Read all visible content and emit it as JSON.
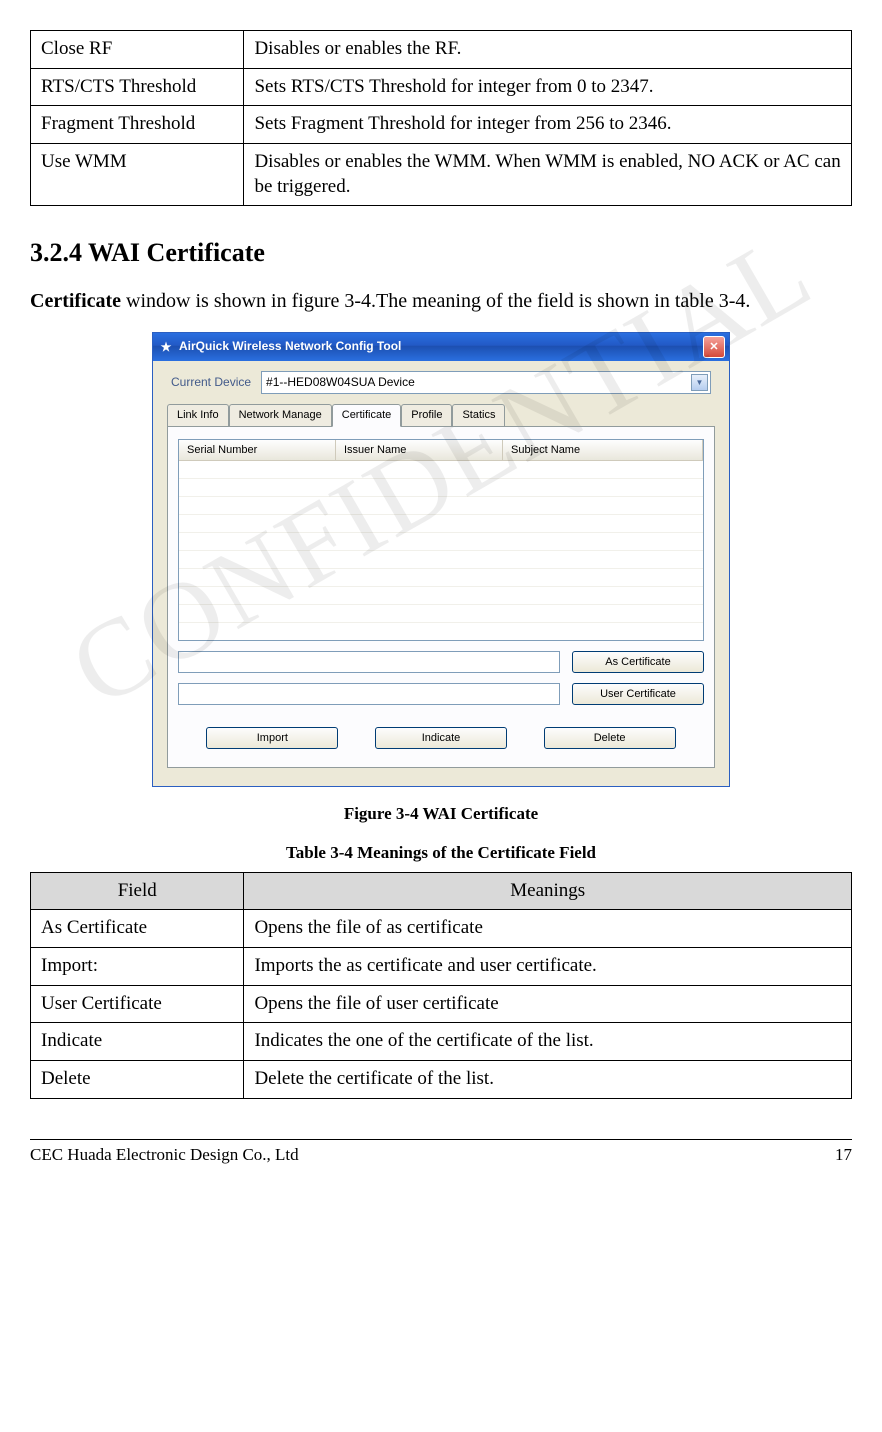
{
  "watermark": "CONFIDENTIAL",
  "topTable": [
    {
      "field": "Close RF",
      "meaning": "Disables or enables the RF."
    },
    {
      "field": "RTS/CTS Threshold",
      "meaning": "Sets RTS/CTS Threshold for integer from 0 to 2347."
    },
    {
      "field": "Fragment Threshold",
      "meaning": "Sets Fragment Threshold for integer from 256 to 2346."
    },
    {
      "field": "Use WMM",
      "meaning": "Disables or enables the WMM. When WMM is enabled, NO ACK or AC can be triggered."
    }
  ],
  "sectionHeading": "3.2.4 WAI Certificate",
  "bodyText": "Certificate window is shown in figure 3-4.The meaning of the field is shown in table 3-4.",
  "bodyBoldWord": "Certificate",
  "bodyRest": " window is shown in figure 3-4.The meaning of the field is shown in table 3-4.",
  "screenshot": {
    "title": "AirQuick Wireless Network Config Tool",
    "deviceLabel": "Current Device",
    "deviceValue": "#1--HED08W04SUA Device",
    "tabs": [
      "Link Info",
      "Network Manage",
      "Certificate",
      "Profile",
      "Statics"
    ],
    "activeTab": "Certificate",
    "listHeaders": [
      "Serial Number",
      "Issuer Name",
      "Subject Name"
    ],
    "btnAsCert": "As Certificate",
    "btnUserCert": "User Certificate",
    "btnImport": "Import",
    "btnIndicate": "Indicate",
    "btnDelete": "Delete"
  },
  "figureCaption": "Figure 3-4 WAI Certificate",
  "tableCaption": "Table 3-4 Meanings of the Certificate Field",
  "table34Headers": {
    "field": "Field",
    "meaning": "Meanings"
  },
  "table34": [
    {
      "field": "As Certificate",
      "meaning": "Opens the file of as certificate"
    },
    {
      "field": "Import:",
      "meaning": "Imports the as certificate and user certificate."
    },
    {
      "field": "User Certificate",
      "meaning": "Opens the file of user certificate"
    },
    {
      "field": "Indicate",
      "meaning": "Indicates the one of the certificate of the list."
    },
    {
      "field": "Delete",
      "meaning": "Delete the certificate of the list."
    }
  ],
  "footer": {
    "left": "CEC Huada Electronic Design Co., Ltd",
    "right": "17"
  }
}
